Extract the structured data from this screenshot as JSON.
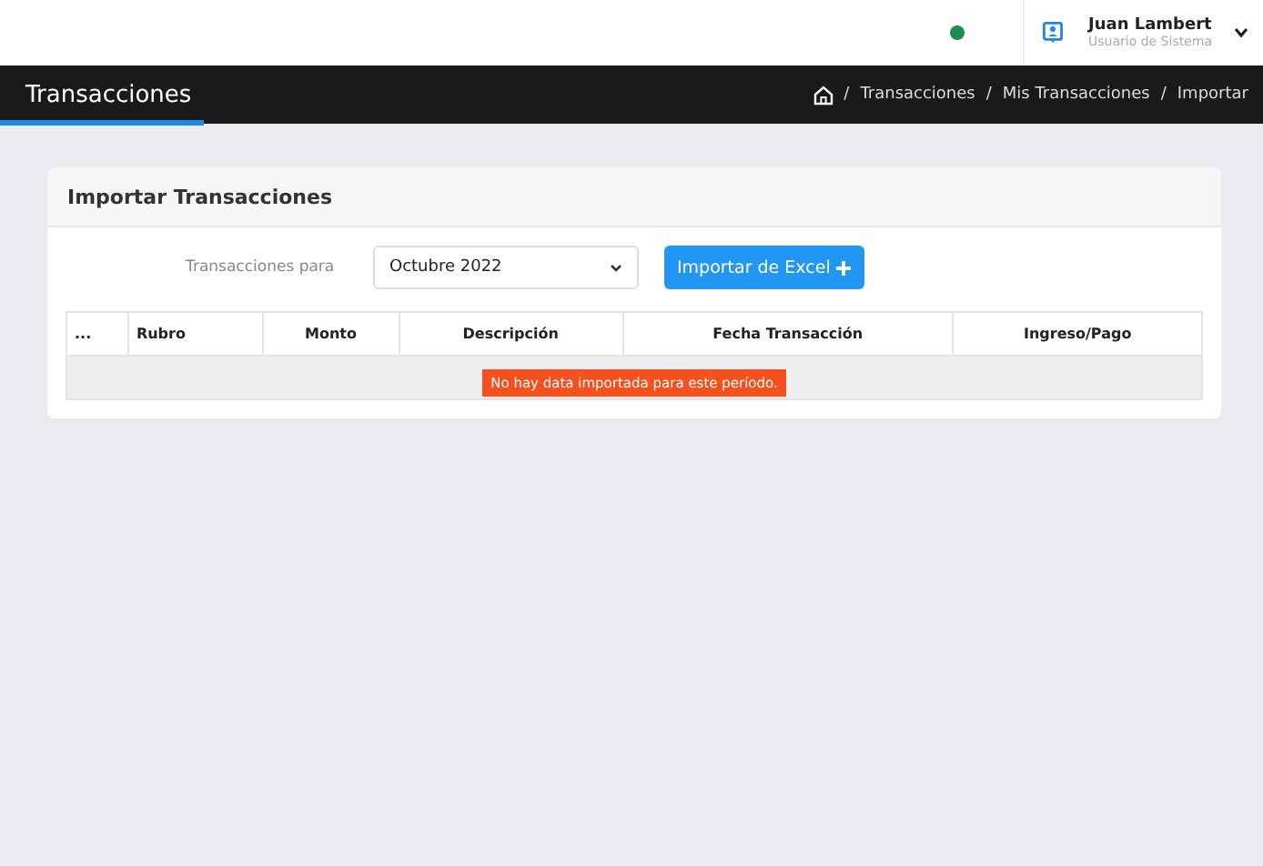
{
  "topbar": {
    "status_online": true,
    "user": {
      "name": "Juan Lambert",
      "role": "Usuario de Sistema"
    }
  },
  "header": {
    "title": "Transacciones",
    "breadcrumb": [
      "Transacciones",
      "Mis Transacciones",
      "Importar"
    ],
    "separator": "/"
  },
  "card": {
    "title": "Importar Transacciones",
    "filter_label": "Transacciones para",
    "period": "Octubre 2022",
    "import_button": "Importar de Excel"
  },
  "table": {
    "columns": [
      "...",
      "Rubro",
      "Monto",
      "Descripción",
      "Fecha Transacción",
      "Ingreso/Pago"
    ],
    "empty_message": "No hay data importada para este período."
  }
}
